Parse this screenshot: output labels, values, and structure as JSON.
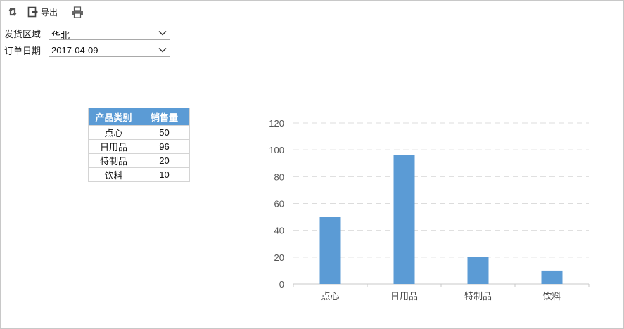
{
  "toolbar": {
    "refresh_icon": "refresh-icon",
    "export_label": "导出",
    "export_icon": "export-icon",
    "print_icon": "printer-icon"
  },
  "params": {
    "region_label": "发货区域",
    "region_value": "华北",
    "date_label": "订单日期",
    "date_value": "2017-04-09"
  },
  "table": {
    "headers": [
      "产品类别",
      "销售量"
    ],
    "rows": [
      [
        "点心",
        "50"
      ],
      [
        "日用品",
        "96"
      ],
      [
        "特制品",
        "20"
      ],
      [
        "饮料",
        "10"
      ]
    ]
  },
  "chart_data": {
    "type": "bar",
    "categories": [
      "点心",
      "日用品",
      "特制品",
      "饮料"
    ],
    "values": [
      50,
      96,
      20,
      10
    ],
    "ylim": [
      0,
      120
    ],
    "yticks": [
      0,
      20,
      40,
      60,
      80,
      100,
      120
    ],
    "grid": true,
    "color": "#5b9bd5"
  }
}
